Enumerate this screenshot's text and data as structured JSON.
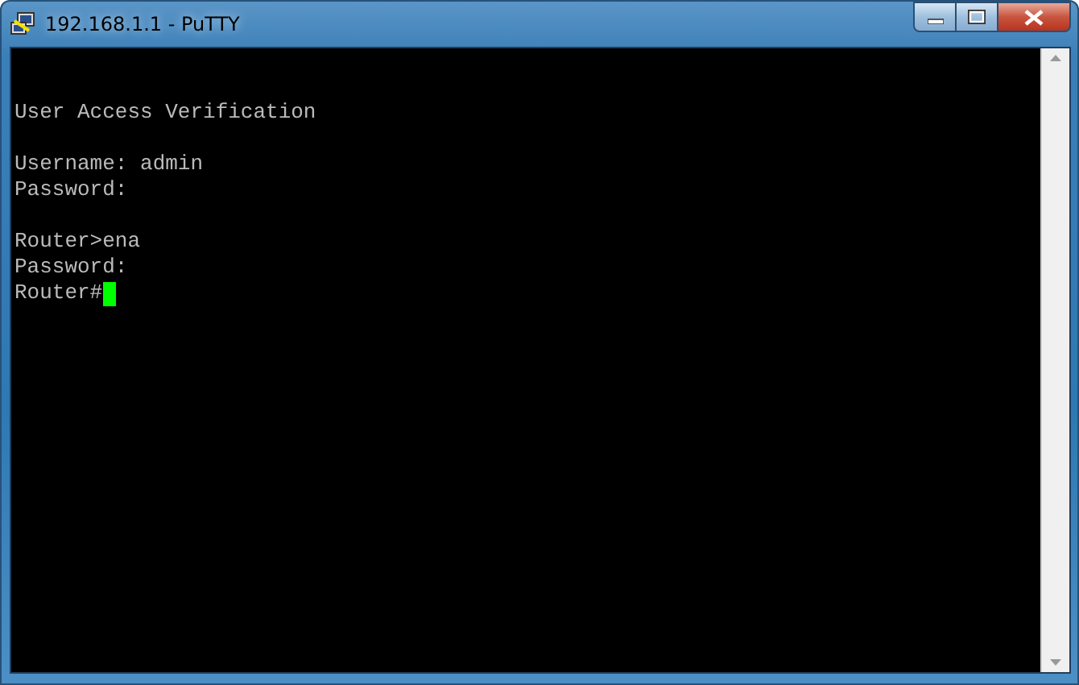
{
  "window": {
    "title": "192.168.1.1 - PuTTY"
  },
  "terminal": {
    "blocks": [
      [
        "User Access Verification"
      ],
      [
        "Username: admin",
        "Password:"
      ],
      [
        "Router>ena",
        "Password:",
        "Router#"
      ]
    ],
    "cursor_visible": true
  }
}
